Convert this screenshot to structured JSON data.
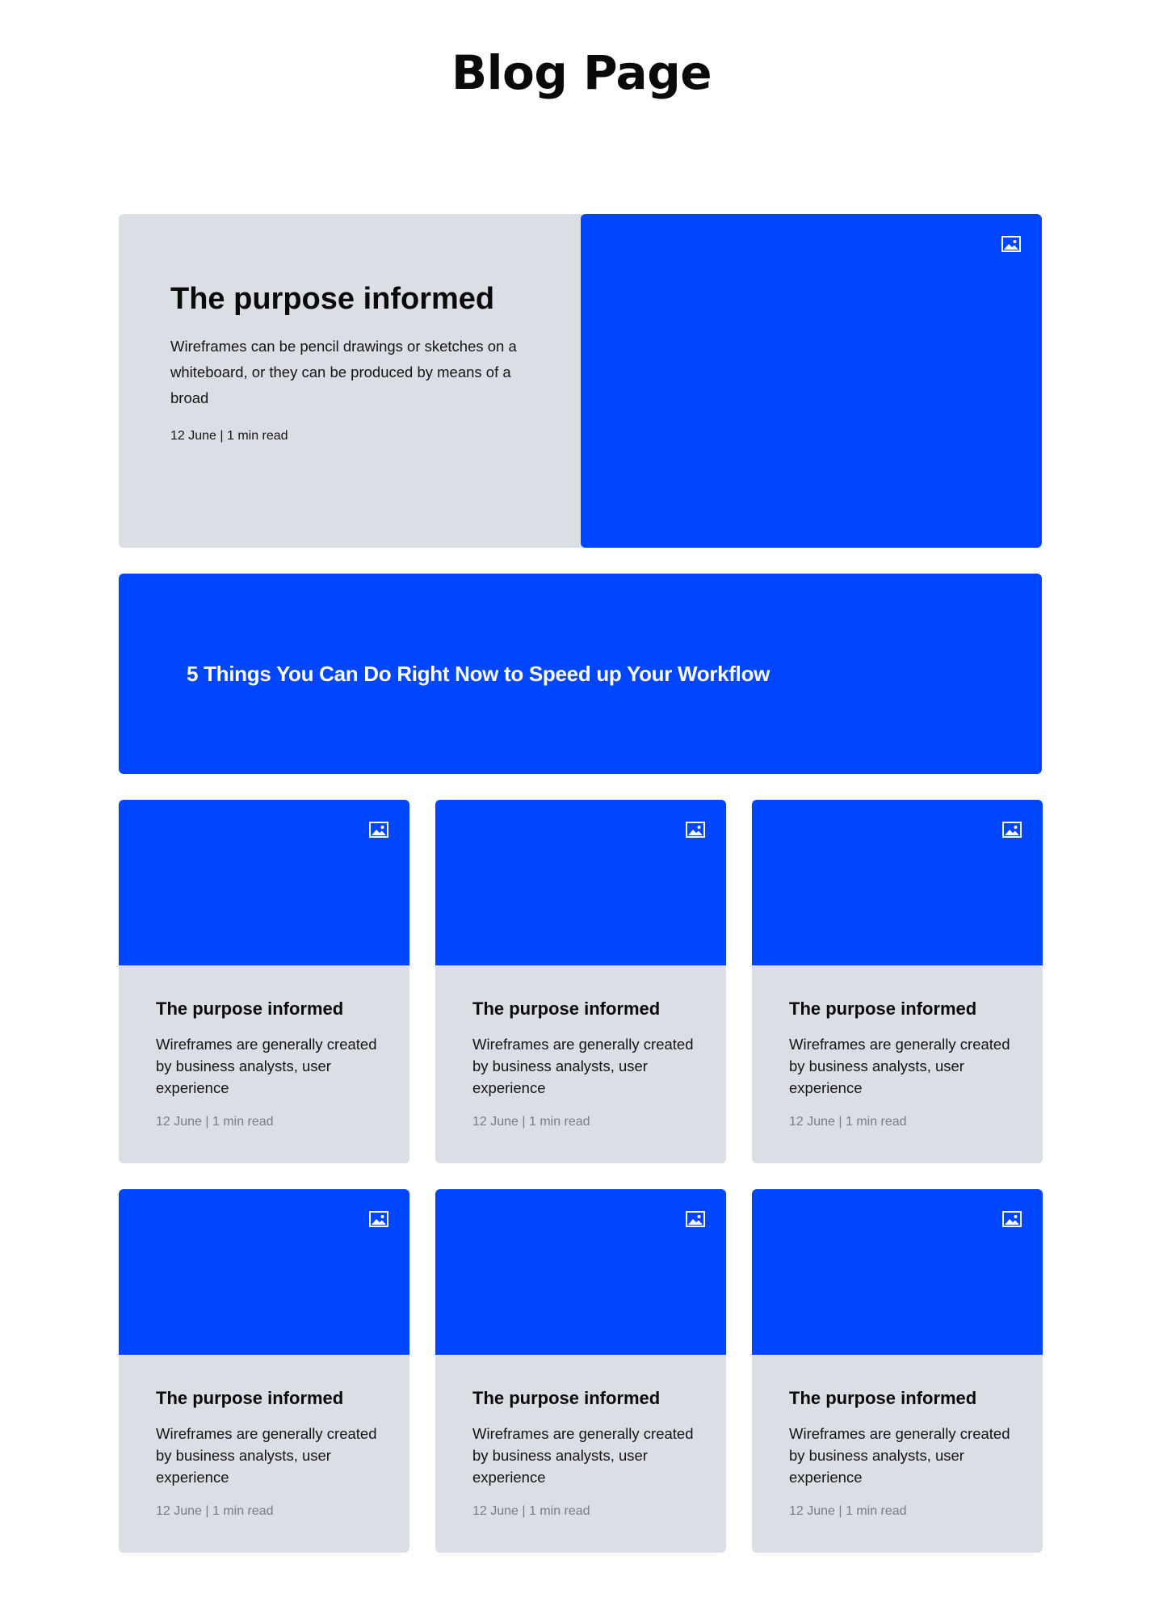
{
  "page": {
    "title": "Blog Page"
  },
  "featured": {
    "title": "The purpose informed",
    "description": "Wireframes can be pencil drawings or sketches on a whiteboard, or they can be produced by means of a broad",
    "meta": "12 June | 1 min read",
    "icon": "image-icon"
  },
  "banner": {
    "title": "5 Things You Can Do Right Now to Speed up Your Workflow"
  },
  "cards": [
    {
      "title": "The purpose informed",
      "description": "Wireframes are generally created by business analysts, user experience",
      "meta": "12 June | 1 min read",
      "icon": "image-icon"
    },
    {
      "title": "The purpose informed",
      "description": "Wireframes are generally created by business analysts, user experience",
      "meta": "12 June | 1 min read",
      "icon": "image-icon"
    },
    {
      "title": "The purpose informed",
      "description": "Wireframes are generally created by business analysts, user experience",
      "meta": "12 June | 1 min read",
      "icon": "image-icon"
    },
    {
      "title": "The purpose informed",
      "description": "Wireframes are generally created by business analysts, user experience",
      "meta": "12 June | 1 min read",
      "icon": "image-icon"
    },
    {
      "title": "The purpose informed",
      "description": "Wireframes are generally created by business analysts, user experience",
      "meta": "12 June | 1 min read",
      "icon": "image-icon"
    },
    {
      "title": "The purpose informed",
      "description": "Wireframes are generally created by business analysts, user experience",
      "meta": "12 June | 1 min read",
      "icon": "image-icon"
    }
  ],
  "colors": {
    "accent": "#0045ff",
    "card_background": "#dcdee6",
    "text": "#0a0a0a",
    "meta_muted": "#7a7c84"
  }
}
